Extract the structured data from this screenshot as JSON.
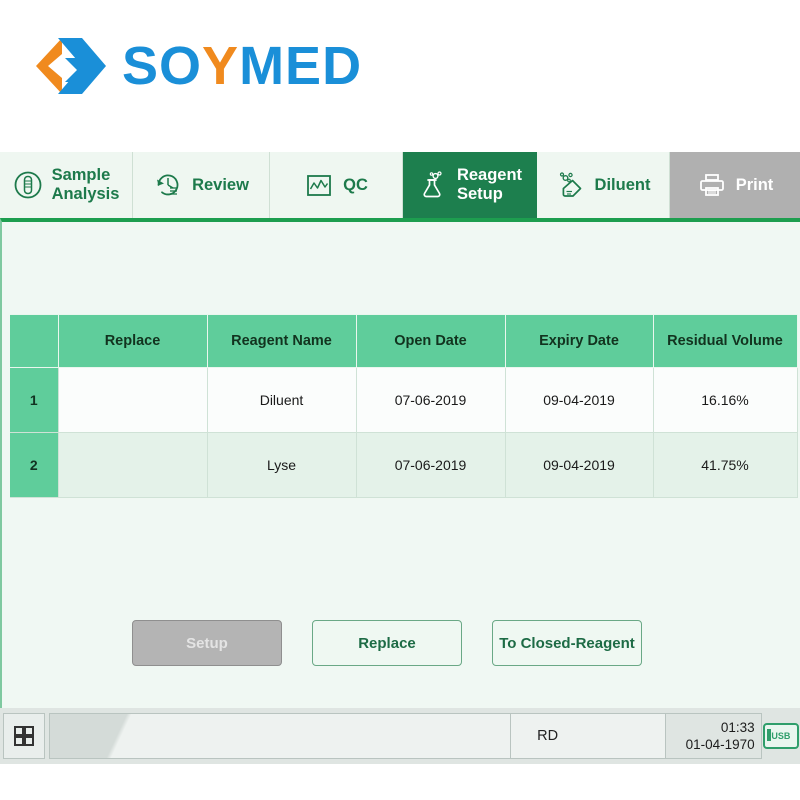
{
  "brand": {
    "name": "SOYMED",
    "name_part1": "SO",
    "name_part2": "Y",
    "name_part3": "MED",
    "logo_icon": "soymed-chevron-logo",
    "color_blue": "#1a8fd8",
    "color_orange": "#f08a1e"
  },
  "tabs": [
    {
      "id": "sample-analysis",
      "label": "Sample\nAnalysis",
      "icon": "test-tube-circle-icon",
      "state": "normal"
    },
    {
      "id": "review",
      "label": "Review",
      "icon": "history-clock-list-icon",
      "state": "normal"
    },
    {
      "id": "qc",
      "label": "QC",
      "icon": "chart-frame-icon",
      "state": "normal"
    },
    {
      "id": "reagent-setup",
      "label": "Reagent\nSetup",
      "icon": "flask-bubbles-icon",
      "state": "active"
    },
    {
      "id": "diluent",
      "label": "Diluent",
      "icon": "droplet-bubbles-icon",
      "state": "normal"
    },
    {
      "id": "print",
      "label": "Print",
      "icon": "printer-icon",
      "state": "disabled"
    }
  ],
  "table": {
    "columns": [
      "",
      "Replace",
      "Reagent Name",
      "Open Date",
      "Expiry Date",
      "Residual Volume"
    ],
    "rows": [
      {
        "index": "1",
        "replace": "",
        "reagent_name": "Diluent",
        "open_date": "07-06-2019",
        "expiry_date": "09-04-2019",
        "residual_volume": "16.16%"
      },
      {
        "index": "2",
        "replace": "",
        "reagent_name": "Lyse",
        "open_date": "07-06-2019",
        "expiry_date": "09-04-2019",
        "residual_volume": "41.75%"
      }
    ]
  },
  "buttons": [
    {
      "id": "setup",
      "label": "Setup",
      "state": "disabled"
    },
    {
      "id": "replace",
      "label": "Replace",
      "state": "enabled"
    },
    {
      "id": "to-closed-reagent",
      "label": "To Closed-Reagent",
      "state": "enabled"
    }
  ],
  "statusbar": {
    "grid_icon": "grid-apps-icon",
    "message": "",
    "mode": "RD",
    "time": "01:33",
    "date": "01-04-1970",
    "usb_icon": "usb-device-icon",
    "usb_label": "USB"
  },
  "colors": {
    "accent_green": "#1d9e4f",
    "tab_active": "#1d7f4e",
    "table_header": "#5fcd9b",
    "panel_bg": "#f0f8f3",
    "disabled_gray": "#b0b0b0"
  }
}
